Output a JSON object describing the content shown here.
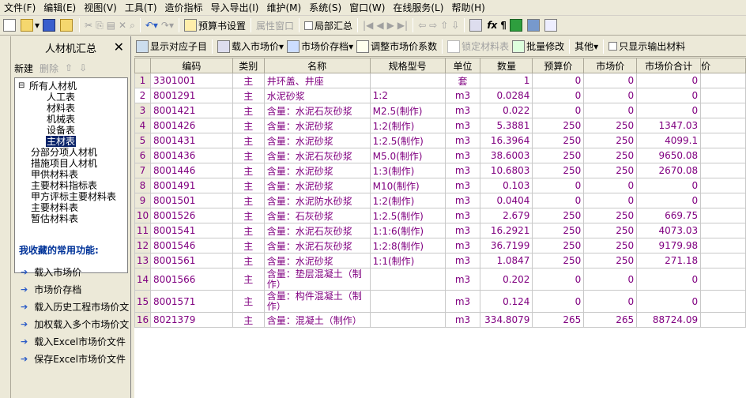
{
  "menu": [
    "文件(F)",
    "编辑(E)",
    "视图(V)",
    "工具(T)",
    "造价指标",
    "导入导出(I)",
    "维护(M)",
    "系统(S)",
    "窗口(W)",
    "在线服务(L)",
    "帮助(H)"
  ],
  "toolbar1": {
    "budget_settings": "预算书设置",
    "attr_window": "属性窗口",
    "local_summary": "局部汇总"
  },
  "left_panel": {
    "title": "人材机汇总",
    "close": "✕",
    "new": "新建",
    "delete": "删除",
    "tree": {
      "root": "所有人材机",
      "children": [
        "人工表",
        "材料表",
        "机械表",
        "设备表",
        "主材表"
      ],
      "others": [
        "分部分项人材机",
        "措施项目人材机",
        "甲供材料表",
        "主要材料指标表",
        "甲方评标主要材料表",
        "主要材料表",
        "暂估材料表"
      ]
    },
    "fav_title": "我收藏的常用功能:",
    "fav_items": [
      "载入市场价",
      "市场价存档",
      "载入历史工程市场价文",
      "加权载入多个市场价文",
      "载入Excel市场价文件",
      "保存Excel市场价文件"
    ]
  },
  "toolbar2": {
    "show_sub": "显示对应子目",
    "load_market": "载入市场价",
    "market_archive": "市场价存档",
    "adjust_coef": "调整市场价系数",
    "lock_materials": "锁定材料表",
    "batch_edit": "批量修改",
    "other": "其他",
    "only_output": "只显示输出材料"
  },
  "grid": {
    "headers": [
      "编码",
      "类别",
      "名称",
      "规格型号",
      "单位",
      "数量",
      "预算价",
      "市场价",
      "市场价合计",
      "价"
    ],
    "rows": [
      {
        "n": "1",
        "code": "3301001",
        "type": "主",
        "name": "井环盖、井座",
        "spec": "",
        "unit": "套",
        "qty": "1",
        "budget": "0",
        "market": "0",
        "total": "0"
      },
      {
        "n": "2",
        "code": "8001291",
        "type": "主",
        "name": "水泥砂浆",
        "spec": "1:2",
        "unit": "m3",
        "qty": "0.0284",
        "budget": "0",
        "market": "0",
        "total": "0"
      },
      {
        "n": "3",
        "code": "8001421",
        "type": "主",
        "name": "含量：水泥石灰砂浆",
        "spec": "M2.5(制作)",
        "unit": "m3",
        "qty": "0.022",
        "budget": "0",
        "market": "0",
        "total": "0"
      },
      {
        "n": "4",
        "code": "8001426",
        "type": "主",
        "name": "含量：水泥砂浆",
        "spec": "1:2(制作)",
        "unit": "m3",
        "qty": "5.3881",
        "budget": "250",
        "market": "250",
        "total": "1347.03"
      },
      {
        "n": "5",
        "code": "8001431",
        "type": "主",
        "name": "含量：水泥砂浆",
        "spec": "1:2.5(制作)",
        "unit": "m3",
        "qty": "16.3964",
        "budget": "250",
        "market": "250",
        "total": "4099.1"
      },
      {
        "n": "6",
        "code": "8001436",
        "type": "主",
        "name": "含量：水泥石灰砂浆",
        "spec": "M5.0(制作)",
        "unit": "m3",
        "qty": "38.6003",
        "budget": "250",
        "market": "250",
        "total": "9650.08"
      },
      {
        "n": "7",
        "code": "8001446",
        "type": "主",
        "name": "含量：水泥砂浆",
        "spec": "1:3(制作)",
        "unit": "m3",
        "qty": "10.6803",
        "budget": "250",
        "market": "250",
        "total": "2670.08"
      },
      {
        "n": "8",
        "code": "8001491",
        "type": "主",
        "name": "含量：水泥砂浆",
        "spec": "M10(制作)",
        "unit": "m3",
        "qty": "0.103",
        "budget": "0",
        "market": "0",
        "total": "0"
      },
      {
        "n": "9",
        "code": "8001501",
        "type": "主",
        "name": "含量：水泥防水砂浆",
        "spec": "1:2(制作)",
        "unit": "m3",
        "qty": "0.0404",
        "budget": "0",
        "market": "0",
        "total": "0"
      },
      {
        "n": "10",
        "code": "8001526",
        "type": "主",
        "name": "含量：石灰砂浆",
        "spec": "1:2.5(制作)",
        "unit": "m3",
        "qty": "2.679",
        "budget": "250",
        "market": "250",
        "total": "669.75"
      },
      {
        "n": "11",
        "code": "8001541",
        "type": "主",
        "name": "含量：水泥石灰砂浆",
        "spec": "1:1:6(制作)",
        "unit": "m3",
        "qty": "16.2921",
        "budget": "250",
        "market": "250",
        "total": "4073.03"
      },
      {
        "n": "12",
        "code": "8001546",
        "type": "主",
        "name": "含量：水泥石灰砂浆",
        "spec": "1:2:8(制作)",
        "unit": "m3",
        "qty": "36.7199",
        "budget": "250",
        "market": "250",
        "total": "9179.98"
      },
      {
        "n": "13",
        "code": "8001561",
        "type": "主",
        "name": "含量：水泥砂浆",
        "spec": "1:1(制作)",
        "unit": "m3",
        "qty": "1.0847",
        "budget": "250",
        "market": "250",
        "total": "271.18"
      },
      {
        "n": "14",
        "code": "8001566",
        "type": "主",
        "name": "含量：垫层混凝土（制作）",
        "spec": "",
        "unit": "m3",
        "qty": "0.202",
        "budget": "0",
        "market": "0",
        "total": "0"
      },
      {
        "n": "15",
        "code": "8001571",
        "type": "主",
        "name": "含量：构件混凝土（制作）",
        "spec": "",
        "unit": "m3",
        "qty": "0.124",
        "budget": "0",
        "market": "0",
        "total": "0"
      },
      {
        "n": "16",
        "code": "8021379",
        "type": "主",
        "name": "含量：混凝土（制作）",
        "spec": "",
        "unit": "m3",
        "qty": "334.8079",
        "budget": "265",
        "market": "265",
        "total": "88724.09"
      }
    ]
  }
}
